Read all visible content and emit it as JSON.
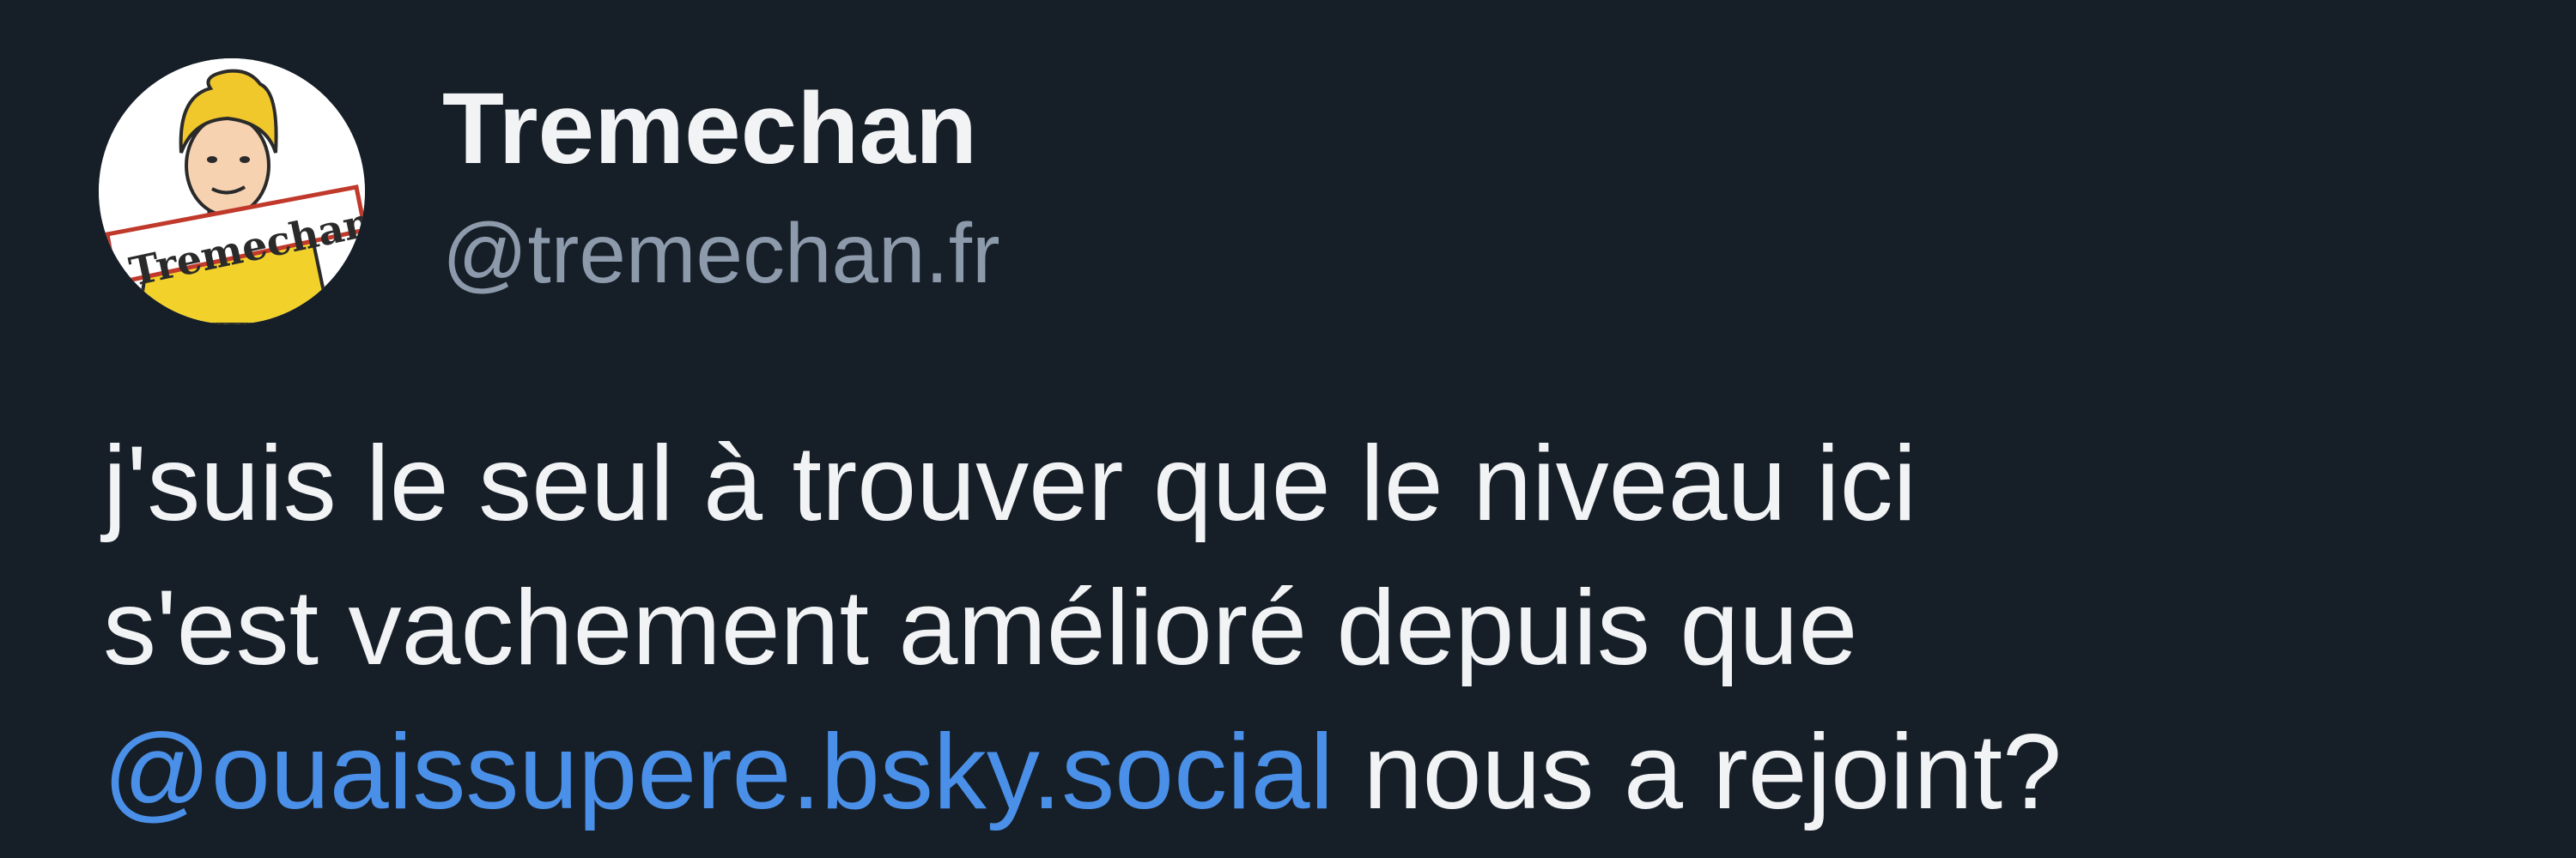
{
  "author": {
    "display_name": "Tremechan",
    "handle": "@tremechan.fr",
    "avatar_text": "Tremechan"
  },
  "post": {
    "line1": "j'suis le seul à trouver que le niveau ici",
    "line2": "s'est vachement amélioré depuis que",
    "mention": "@ouaissupere.bsky.social",
    "line3_rest": " nous a rejoint?"
  },
  "colors": {
    "background": "#161e27",
    "text": "#f1f3f5",
    "handle": "#8c9aab",
    "mention": "#4a90e8"
  }
}
